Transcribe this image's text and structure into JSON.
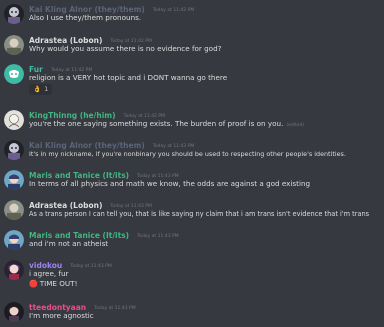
{
  "colors": {
    "background": "#36393f",
    "text": "#dcddde",
    "muted": "#72767d",
    "author_kai": "#5c647a",
    "author_default": "#dcddde",
    "author_fur": "#3fbaa4",
    "author_green": "#43b581",
    "author_vidokou": "#9b84ee",
    "author_pink": "#ea4f8a"
  },
  "messages": [
    {
      "author": "Kai Kling Alnor (they/them)",
      "timestamp": "Today at 11:42 PM",
      "lines": [
        "Also I use they/them pronouns."
      ],
      "avatar_icon": "cartoon-avatar-icon"
    },
    {
      "author": "Adrastea (Lobon)",
      "timestamp": "Today at 11:42 PM",
      "lines": [
        "Why would you assume there is no evidence for god?"
      ],
      "avatar_icon": "photo-avatar-icon"
    },
    {
      "author": "Fur",
      "timestamp": "Today at 11:42 PM",
      "lines": [
        "religion is a VERY hot topic and i DONT wanna go there"
      ],
      "reaction": {
        "emoji": "👌",
        "count": "1"
      },
      "avatar_icon": "discord-default-avatar-icon"
    },
    {
      "author": "KingThinng (he/him)",
      "timestamp": "Today at 11:42 PM",
      "lines": [
        "you're the one saying something exists. The burden of proof is on you."
      ],
      "edited": "(edited)",
      "avatar_icon": "drawn-avatar-icon"
    },
    {
      "author": "Kai Kling Alnor (they/them)",
      "timestamp": "Today at 11:43 PM",
      "lines": [
        "It's in my nickname, if you're nonbinary you should be used to respecting other people's identities."
      ],
      "avatar_icon": "cartoon-avatar-icon"
    },
    {
      "author": "Maris and Tanice (It/its)",
      "timestamp": "Today at 11:43 PM",
      "lines": [
        "In terms of all physics and math we know, the odds are against a god existing"
      ],
      "avatar_icon": "cartoon-avatar-icon"
    },
    {
      "author": "Adrastea (Lobon)",
      "timestamp": "Today at 11:43 PM",
      "lines": [
        "As a trans person I can tell you, that is like saying ny claim that i am trans isn't evidence that i'm trans"
      ],
      "avatar_icon": "photo-avatar-icon"
    },
    {
      "author": "Maris and Tanice (It/its)",
      "timestamp": "Today at 11:43 PM",
      "lines": [
        "and i'm not an atheist"
      ],
      "avatar_icon": "cartoon-avatar-icon"
    },
    {
      "author": "vidokou",
      "timestamp": "Today at 11:43 PM",
      "lines": [
        "i agree, fur",
        "TIME OUT!"
      ],
      "timeout_emoji": "🛑",
      "avatar_icon": "anime-avatar-icon"
    },
    {
      "author": "tteedontyaan",
      "timestamp": "Today at 11:43 PM",
      "lines": [
        "I'm more agnostic"
      ],
      "avatar_icon": "anime-avatar-icon"
    }
  ]
}
